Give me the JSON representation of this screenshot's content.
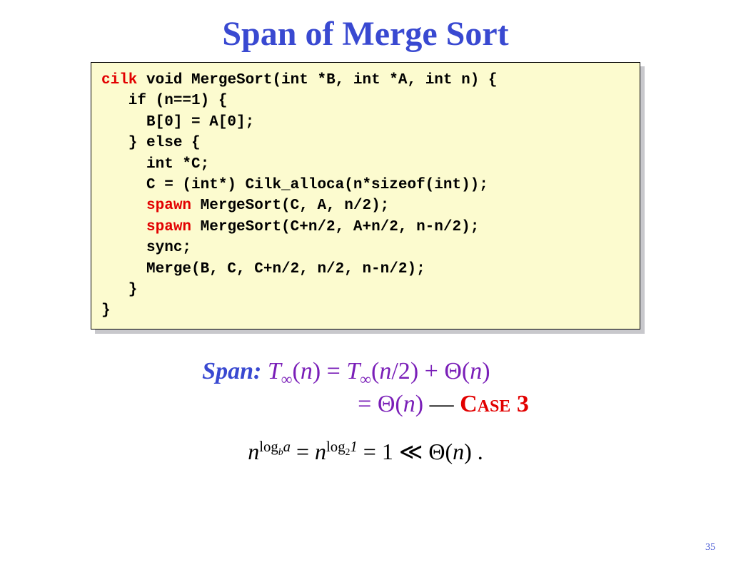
{
  "title": "Span of Merge Sort",
  "code": {
    "kw_cilk": "cilk",
    "line1_rest": " void MergeSort(int *B, int *A, int n) {",
    "line2": "   if (n==1) {",
    "line3": "     B[0] = A[0];",
    "line4": "   } else {",
    "line5": "     int *C;",
    "line6": "     C = (int*) Cilk_alloca(n*sizeof(int));",
    "line7_indent": "     ",
    "kw_spawn": "spawn",
    "line7_rest": " MergeSort(C, A, n/2);",
    "line8_rest": " MergeSort(C+n/2, A+n/2, n-n/2);",
    "line9": "     sync;",
    "line10": "     Merge(B, C, C+n/2, n/2, n-n/2);",
    "line11": "   }",
    "line12": "}"
  },
  "eq": {
    "span_label": "Span:",
    "lhs_T": "T",
    "inf": "∞",
    "n": "n",
    "eq_sign": " = ",
    "over2": "/2",
    "plus": " + ",
    "theta": "Θ",
    "open": "(",
    "close": ")",
    "dash": "  —  ",
    "case_label": "Case 3"
  },
  "bottom": {
    "n": "n",
    "log": "log",
    "b": "b",
    "a": "a",
    "two": "2",
    "one": "1",
    "eq": " = ",
    "eq_one": " = 1 ",
    "muchless": "≪",
    "theta": " Θ",
    "open": "(",
    "close": ")",
    "period": " ."
  },
  "page_number": "35"
}
